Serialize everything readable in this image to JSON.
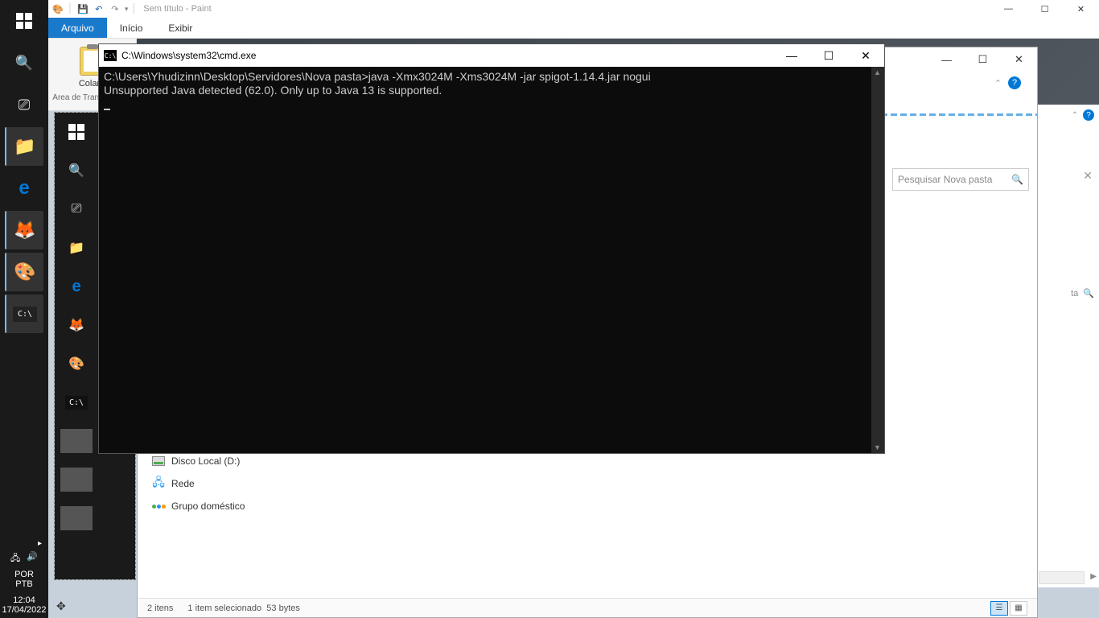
{
  "taskbar": {
    "tray": {
      "lang1": "POR",
      "lang2": "PTB",
      "time": "12:04",
      "date": "17/04/2022"
    }
  },
  "paint": {
    "title": "Sem título - Paint",
    "tabs": {
      "file": "Arquivo",
      "home": "Início",
      "view": "Exibir"
    },
    "ribbon": {
      "paste": "Colar",
      "clipboard": "Área de Transferência"
    }
  },
  "cmd": {
    "title": "C:\\Windows\\system32\\cmd.exe",
    "line1": "C:\\Users\\Yhudizinn\\Desktop\\Servidores\\Nova pasta>java -Xmx3024M -Xms3024M -jar spigot-1.14.4.jar nogui",
    "line2": "Unsupported Java detected (62.0). Only up to Java 13 is supported."
  },
  "explorer": {
    "search_placeholder": "Pesquisar Nova pasta",
    "sidebar": {
      "disk": "Disco Local (D:)",
      "network": "Rede",
      "homegroup": "Grupo doméstico"
    },
    "status": {
      "items": "2 itens",
      "selected": "1 item selecionado",
      "size": "53 bytes"
    }
  },
  "explorer2": {
    "search_tail": "ta"
  }
}
